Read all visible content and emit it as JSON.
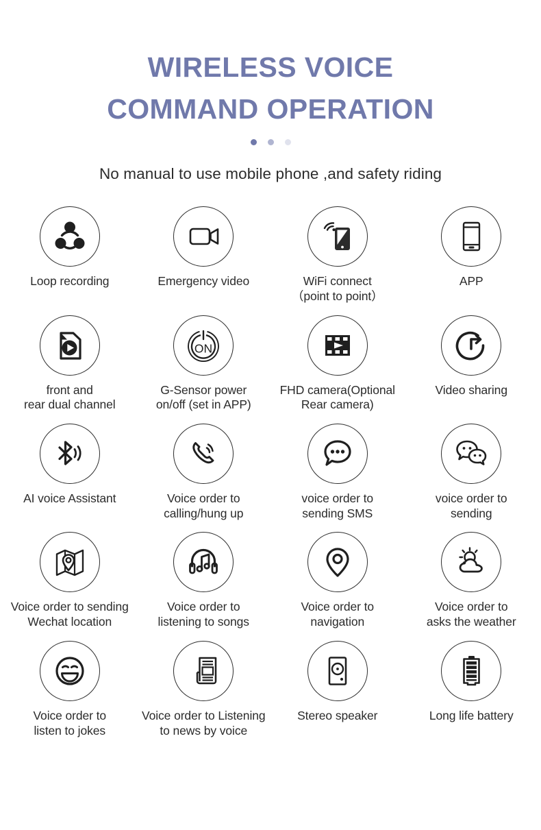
{
  "header": {
    "title_line1": "WIRELESS VOICE",
    "title_line2": "COMMAND OPERATION",
    "title_color": "#7079ab",
    "subtitle": "No manual to use mobile phone ,and safety riding",
    "carousel_dots": 3
  },
  "features": [
    {
      "icon": "loop-recording-icon",
      "label": "Loop recording"
    },
    {
      "icon": "camcorder-icon",
      "label": "Emergency video"
    },
    {
      "icon": "wifi-phone-icon",
      "label": "WiFi connect\n（point to point）"
    },
    {
      "icon": "smartphone-icon",
      "label": "APP"
    },
    {
      "icon": "video-file-icon",
      "label": "front and\nrear dual channel"
    },
    {
      "icon": "power-on-icon",
      "label": "G-Sensor power\non/off  (set in APP)"
    },
    {
      "icon": "film-strip-icon",
      "label": "FHD camera(Optional\nRear camera)"
    },
    {
      "icon": "share-arrow-icon",
      "label": "Video sharing"
    },
    {
      "icon": "bluetooth-voice-icon",
      "label": "AI voice Assistant"
    },
    {
      "icon": "phone-call-icon",
      "label": "Voice order to\ncalling/hung up"
    },
    {
      "icon": "chat-bubble-icon",
      "label": "voice order to\nsending SMS"
    },
    {
      "icon": "wechat-bubbles-icon",
      "label": "voice order to\nsending"
    },
    {
      "icon": "map-pin-icon",
      "label": "Voice order to sending\nWechat location"
    },
    {
      "icon": "headphones-music-icon",
      "label": "Voice order to\nlistening to songs"
    },
    {
      "icon": "location-pin-icon",
      "label": "Voice order to\nnavigation"
    },
    {
      "icon": "sun-cloud-icon",
      "label": "Voice order to\nasks the weather"
    },
    {
      "icon": "smiley-face-icon",
      "label": "Voice order to\nlisten to jokes"
    },
    {
      "icon": "newspaper-icon",
      "label": "Voice order to Listening\nto news by voice"
    },
    {
      "icon": "speaker-icon",
      "label": "Stereo speaker"
    },
    {
      "icon": "battery-icon",
      "label": "Long life battery"
    }
  ]
}
